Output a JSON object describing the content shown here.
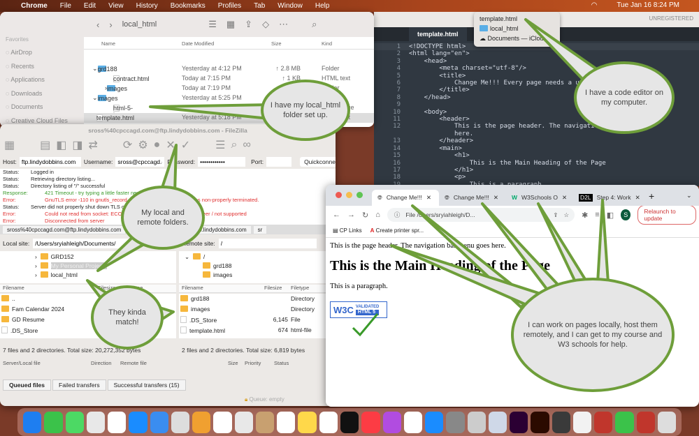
{
  "menubar": {
    "app": "Chrome",
    "items": [
      "File",
      "Edit",
      "View",
      "History",
      "Bookmarks",
      "Profiles",
      "Tab",
      "Window",
      "Help"
    ],
    "clock": "Tue Jan 16  8:24 PM"
  },
  "sublime": {
    "status": "UNREGISTERED",
    "tab": "template.html",
    "code": [
      "<!DOCTYPE html>",
      "<html lang=\"en\">",
      "    <head>",
      "        <meta charset=\"utf-8\"/>",
      "        <title>",
      "            Change Me!!! Every page needs a uniq",
      "        </title>",
      "    </head>",
      "",
      "    <body>",
      "        <header>",
      "            This is the page header. The navigati",
      "            here.",
      "        </header>",
      "        <main>",
      "            <h1>",
      "                This is the Main Heading of the Page",
      "            </h1>",
      "            <p>",
      "                This is a paragraph"
    ],
    "line_numbers": [
      "1",
      "2",
      "3",
      "4",
      "5",
      "6",
      "7",
      "8",
      "9",
      "10",
      "11",
      "12",
      "",
      "13",
      "14",
      "15",
      "16",
      "17",
      "18",
      "19"
    ]
  },
  "dropdown": {
    "items": [
      "template.html",
      "local_html",
      "Documents — iCloud"
    ]
  },
  "finder": {
    "title": "local_html",
    "favorites_label": "Favorites",
    "sidebar": [
      "AirDrop",
      "Recents",
      "Applications",
      "Downloads",
      "Documents",
      "Creative Cloud Files"
    ],
    "columns": [
      "Name",
      "Date Modified",
      "Size",
      "Kind"
    ],
    "rows": [
      {
        "name": "grd188",
        "date": "Yesterday at 4:12 PM",
        "size": "↑ 2.8 MB",
        "kind": "Folder"
      },
      {
        "name": "contract.html",
        "date": "Today at 7:15 PM",
        "size": "↑ 1 KB",
        "kind": "HTML text"
      },
      {
        "name": "images",
        "date": "Today at 7:19 PM",
        "size": "--",
        "kind": "Folder"
      },
      {
        "name": "images",
        "date": "Yesterday at 5:25 PM",
        "size": "↑ 9 KB",
        "kind": "Folder"
      },
      {
        "name": "html-5-logo.png",
        "date": "Yesterday at 5:33 PM",
        "size": "",
        "kind": "PNG image"
      },
      {
        "name": "template.html",
        "date": "Yesterday at 5:18 PM",
        "size": "",
        "kind": "HTML text"
      }
    ]
  },
  "filezilla": {
    "title": "sross%40cpccagd.com@ftp.lindydobbins.com - FileZilla",
    "host_label": "Host:",
    "host": "ftp.lindydobbins.com",
    "user_label": "Username:",
    "user": "sross@cpccagd.com",
    "pass_label": "Password:",
    "pass": "••••••••••••",
    "port_label": "Port:",
    "quickconnect": "Quickconnect",
    "log": [
      {
        "k": "Status:",
        "m": "Logged in",
        "c": ""
      },
      {
        "k": "Status:",
        "m": "Retrieving directory listing...",
        "c": ""
      },
      {
        "k": "Status:",
        "m": "Directory listing of \"/\" successful",
        "c": ""
      },
      {
        "k": "Response:",
        "m": "421 Timeout - try typing a little faster next time",
        "c": "green"
      },
      {
        "k": "Error:",
        "m": "GnuTLS error -110 in gnutls_record_recv: The TLS connection was non-properly terminated.",
        "c": "red"
      },
      {
        "k": "Status:",
        "m": "Server did not properly shut down TLS connection",
        "c": ""
      },
      {
        "k": "Error:",
        "m": "Could not read from socket: ECONNRESET - Connection reset by peer / not supported",
        "c": "red"
      },
      {
        "k": "Error:",
        "m": "Disconnected from server",
        "c": "red"
      }
    ],
    "tabs": [
      "sross%40cpccagd.com@ftp.lindydobbins.com",
      "sross%40cpccagd.com@ftp.lindydobbins.com",
      "sr"
    ],
    "local_label": "Local site:",
    "local_path": "/Users/sryiahleigh/Documents/",
    "remote_label": "Remote site:",
    "remote_path": "/",
    "local_tree": [
      "GRD152",
      "My Personal Projects",
      "local_html"
    ],
    "remote_tree": [
      "/",
      "grd188",
      "images"
    ],
    "cols": [
      "Filename",
      "Filesize",
      "Filetype"
    ],
    "local_files": [
      "..",
      "Fam Calendar 2024",
      "GD Resume",
      ".DS_Store"
    ],
    "remote_files": [
      {
        "n": "grd188",
        "s": "",
        "t": "Directory"
      },
      {
        "n": "images",
        "s": "",
        "t": "Directory"
      },
      {
        "n": ".DS_Store",
        "s": "6,145",
        "t": "File"
      },
      {
        "n": "template.html",
        "s": "674",
        "t": "html-file"
      }
    ],
    "local_status": "7 files and 2 directories. Total size: 20,272,352 bytes",
    "remote_status": "2 files and 2 directories. Total size: 6,819 bytes",
    "queue_cols": [
      "Server/Local file",
      "Direction",
      "Remote file",
      "Size",
      "Priority",
      "Status"
    ],
    "queue_tabs": [
      "Queued files",
      "Failed transfers",
      "Successful transfers (15)"
    ],
    "queue_status": "Queue: empty"
  },
  "chrome": {
    "tabs": [
      "Change Me!!!",
      "Change Me!!!",
      "W3Schools O",
      "Step 4: Work"
    ],
    "url": "File  /Users/sryiahleigh/D...",
    "relaunch": "Relaunch to update",
    "profile": "S",
    "bookmarks": [
      "CP Links",
      "Create printer spr..."
    ],
    "page": {
      "header": "This is the page header. The navigation bar menu goes here.",
      "h1": "This is the Main Heading of the Page",
      "p": "This is a paragraph.",
      "badge": "W3C",
      "badge_sub": "HTML 5",
      "badge_top": "VALIDATED"
    }
  },
  "callouts": [
    "I have my local_html folder set up.",
    "I have a code editor on my computer.",
    "My local and remote folders.",
    "They kinda match!",
    "I can work on pages locally, host them remotely, and I can get to my course and W3 schools for help."
  ],
  "colors": {
    "callout_border": "#6e9e3a",
    "callout_fill": "#e6e6e6"
  }
}
